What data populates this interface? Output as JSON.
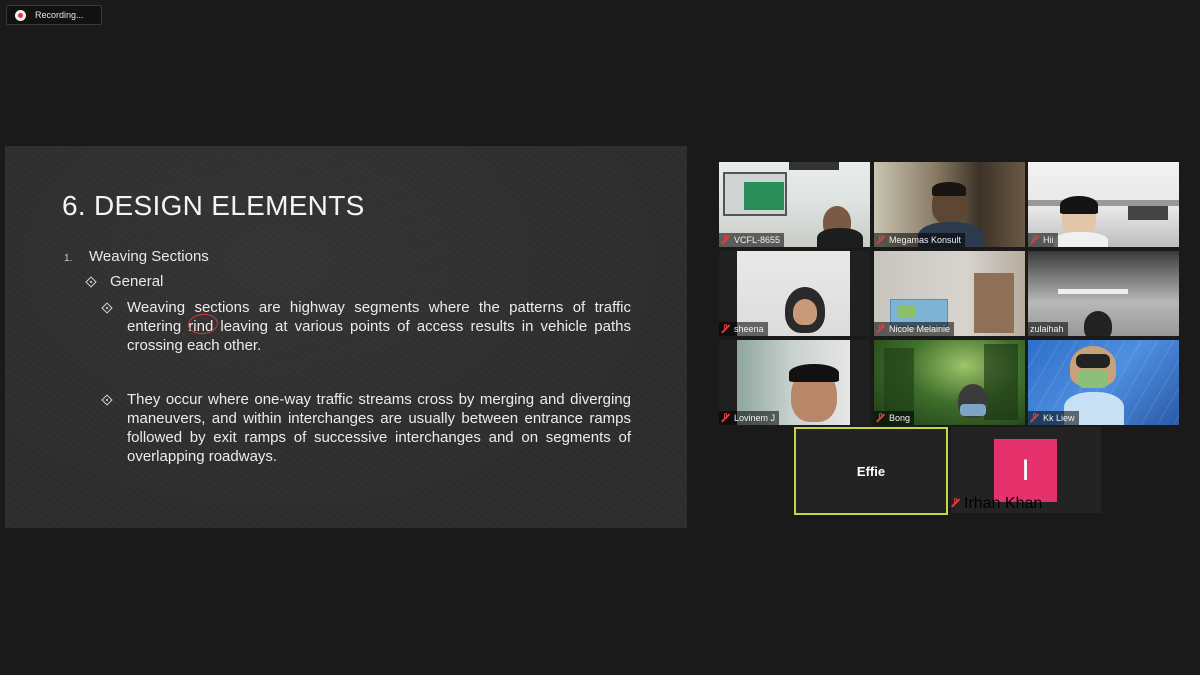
{
  "recording": {
    "label": "Recording..."
  },
  "slide": {
    "title": "6. DESIGN ELEMENTS",
    "item_number": "1.",
    "item_label": "Weaving Sections",
    "subitem_label": "General",
    "bullets": [
      "Weaving sections are highway segments where the patterns of traffic entering rind leaving at various points of access results in vehicle paths crossing each other.",
      "They occur where one-way traffic streams cross by merging and diverging maneuvers, and within interchanges are usually between entrance ramps followed by exit ramps of successive interchanges and on segments of overlapping roadways."
    ]
  },
  "participants": [
    {
      "name": "VCFL-8655",
      "muted": true
    },
    {
      "name": "Megamas Konsult",
      "muted": true
    },
    {
      "name": "Hii",
      "muted": true
    },
    {
      "name": "sheena",
      "muted": true
    },
    {
      "name": "Nicole Melainie",
      "muted": true
    },
    {
      "name": "zulaihah",
      "muted": false
    },
    {
      "name": "Lovinem J",
      "muted": true
    },
    {
      "name": "Bong",
      "muted": true
    },
    {
      "name": "Kk Liew",
      "muted": true
    },
    {
      "name": "Effie",
      "speaking": true
    },
    {
      "name": "Irhan Khan",
      "muted": true,
      "avatar_letter": "I"
    }
  ],
  "colors": {
    "speaker_border": "#c7d645",
    "muted_icon": "#e23b3b",
    "avatar_bg": "#e5326c"
  }
}
